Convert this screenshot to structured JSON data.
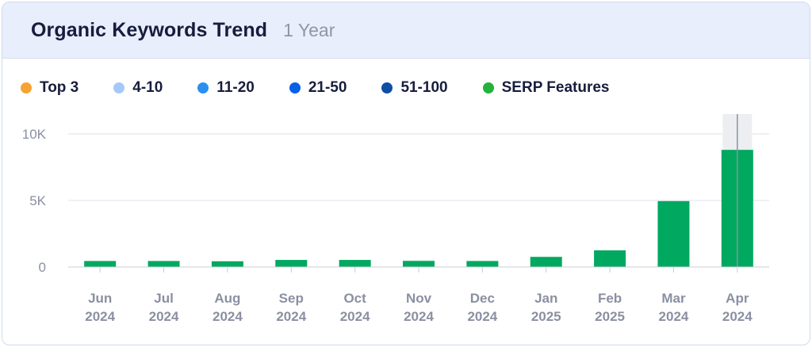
{
  "header": {
    "title": "Organic Keywords Trend",
    "period": "1 Year"
  },
  "legend": [
    {
      "label": "Top 3",
      "color": "#f7a233"
    },
    {
      "label": "4-10",
      "color": "#a5c9f7"
    },
    {
      "label": "11-20",
      "color": "#2c8ef0"
    },
    {
      "label": "21-50",
      "color": "#0a5fe8"
    },
    {
      "label": "51-100",
      "color": "#0d4ea6"
    },
    {
      "label": "SERP Features",
      "color": "#22b33a"
    }
  ],
  "chart_data": {
    "type": "bar",
    "categories": [
      {
        "month": "Jun",
        "year": "2024"
      },
      {
        "month": "Jul",
        "year": "2024"
      },
      {
        "month": "Aug",
        "year": "2024"
      },
      {
        "month": "Sep",
        "year": "2024"
      },
      {
        "month": "Oct",
        "year": "2024"
      },
      {
        "month": "Nov",
        "year": "2024"
      },
      {
        "month": "Dec",
        "year": "2024"
      },
      {
        "month": "Jan",
        "year": "2025"
      },
      {
        "month": "Feb",
        "year": "2025"
      },
      {
        "month": "Mar",
        "year": "2024"
      },
      {
        "month": "Apr",
        "year": "2024"
      }
    ],
    "values": [
      450,
      450,
      430,
      530,
      530,
      460,
      450,
      760,
      1250,
      4950,
      8800
    ],
    "bar_color": "#00a860",
    "y_ticks": [
      {
        "value": 0,
        "label": "0"
      },
      {
        "value": 5000,
        "label": "5K"
      },
      {
        "value": 10000,
        "label": "10K"
      }
    ],
    "ylim": [
      0,
      10000
    ],
    "highlighted_index": 10,
    "grid": true
  }
}
